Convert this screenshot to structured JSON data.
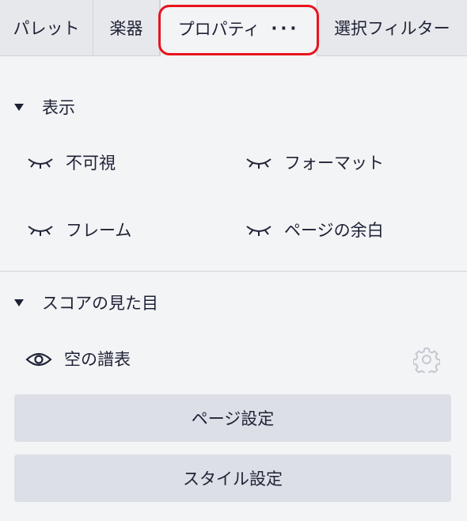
{
  "tabs": [
    {
      "label": "パレット"
    },
    {
      "label": "楽器"
    },
    {
      "label": "プロパティ",
      "more": "···"
    },
    {
      "label": "選択フィルター"
    }
  ],
  "colors": {
    "highlight": "#e8141d",
    "background": "#f3f4f6",
    "button": "#dcdfe5",
    "text": "#1e2235"
  },
  "display_section": {
    "title": "表示",
    "expanded": true,
    "items": [
      {
        "label": "不可視",
        "icon": "eye-closed-icon",
        "visible": false
      },
      {
        "label": "フォーマット",
        "icon": "eye-closed-icon",
        "visible": false
      },
      {
        "label": "フレーム",
        "icon": "eye-closed-icon",
        "visible": false
      },
      {
        "label": "ページの余白",
        "icon": "eye-closed-icon",
        "visible": false
      }
    ]
  },
  "score_section": {
    "title": "スコアの見た目",
    "expanded": true,
    "empty_staves": {
      "label": "空の譜表",
      "icon": "eye-open-icon",
      "visible": true,
      "settings_icon": "gear-icon"
    },
    "page_settings_button": "ページ設定",
    "style_settings_button": "スタイル設定"
  }
}
